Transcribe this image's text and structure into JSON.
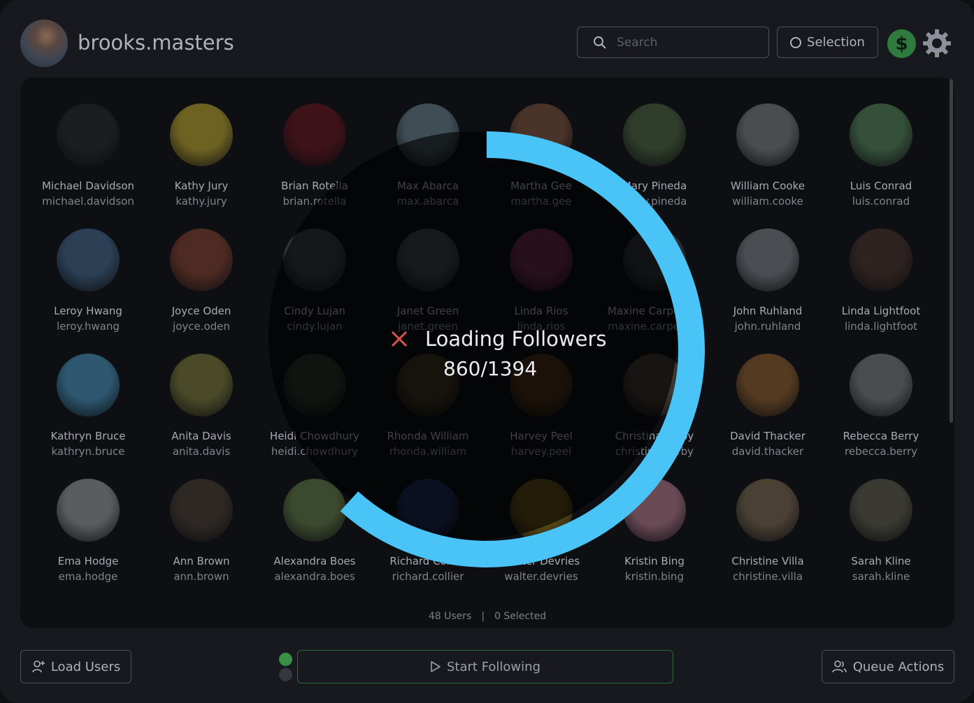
{
  "header": {
    "username": "brooks.masters",
    "search_placeholder": "Search",
    "selection_label": "Selection",
    "dollar_symbol": "$"
  },
  "users": [
    {
      "name": "Michael Davidson",
      "handle": "michael.davidson",
      "color": "#1b1d20"
    },
    {
      "name": "Kathy Jury",
      "handle": "kathy.jury",
      "color": "#6e6222"
    },
    {
      "name": "Brian Rotella",
      "handle": "brian.rotella",
      "color": "#3d1218"
    },
    {
      "name": "Max Abarca",
      "handle": "max.abarca",
      "color": "#3f4d55"
    },
    {
      "name": "Martha Gee",
      "handle": "martha.gee",
      "color": "#4a3328"
    },
    {
      "name": "Mary Pineda",
      "handle": "mary.pineda",
      "color": "#2f3d2a"
    },
    {
      "name": "William Cooke",
      "handle": "william.cooke",
      "color": "#4a4c50"
    },
    {
      "name": "Luis Conrad",
      "handle": "luis.conrad",
      "color": "#35503a"
    },
    {
      "name": "Leroy Hwang",
      "handle": "leroy.hwang",
      "color": "#2c3f55"
    },
    {
      "name": "Joyce Oden",
      "handle": "joyce.oden",
      "color": "#4d2a22"
    },
    {
      "name": "Cindy Lujan",
      "handle": "cindy.lujan",
      "color": "#3a3d40"
    },
    {
      "name": "Janet Green",
      "handle": "janet.green",
      "color": "#3f4244"
    },
    {
      "name": "Linda Rios",
      "handle": "linda.rios",
      "color": "#6b2a45"
    },
    {
      "name": "Maxine Carpenter",
      "handle": "maxine.carpenter",
      "color": "#2e3135"
    },
    {
      "name": "John Ruhland",
      "handle": "john.ruhland",
      "color": "#4a4d52"
    },
    {
      "name": "Linda Lightfoot",
      "handle": "linda.lightfoot",
      "color": "#2e2320"
    },
    {
      "name": "Kathryn Bruce",
      "handle": "kathryn.bruce",
      "color": "#2d5870"
    },
    {
      "name": "Anita Davis",
      "handle": "anita.davis",
      "color": "#4a4a28"
    },
    {
      "name": "Heidi Chowdhury",
      "handle": "heidi.chowdhury",
      "color": "#2c3328"
    },
    {
      "name": "Rhonda William",
      "handle": "rhonda.william",
      "color": "#3a3222"
    },
    {
      "name": "Harvey Peel",
      "handle": "harvey.peel",
      "color": "#4a2e18"
    },
    {
      "name": "Christina Yerby",
      "handle": "christina.yerby",
      "color": "#3e3630"
    },
    {
      "name": "David Thacker",
      "handle": "david.thacker",
      "color": "#553a22"
    },
    {
      "name": "Rebecca Berry",
      "handle": "rebecca.berry",
      "color": "#4a4c50"
    },
    {
      "name": "Ema Hodge",
      "handle": "ema.hodge",
      "color": "#5a5d60"
    },
    {
      "name": "Ann Brown",
      "handle": "ann.brown",
      "color": "#2e2824"
    },
    {
      "name": "Alexandra Boes",
      "handle": "alexandra.boes",
      "color": "#3b4a2e"
    },
    {
      "name": "Richard Collier",
      "handle": "richard.collier",
      "color": "#1e2a55"
    },
    {
      "name": "Walter Devries",
      "handle": "walter.devries",
      "color": "#5a4a18"
    },
    {
      "name": "Kristin Bing",
      "handle": "kristin.bing",
      "color": "#6a4a55"
    },
    {
      "name": "Christine Villa",
      "handle": "christine.villa",
      "color": "#4a4034"
    },
    {
      "name": "Sarah Kline",
      "handle": "sarah.kline",
      "color": "#3a3a32"
    }
  ],
  "status": {
    "users_count": "48 Users",
    "separator": "|",
    "selected_count": "0 Selected"
  },
  "loading": {
    "title": "Loading Followers",
    "progress_text": "860/1394",
    "progress_fraction": 0.617,
    "ring_color": "#4ac3f7"
  },
  "footer": {
    "load_users_label": "Load Users",
    "start_following_label": "Start Following",
    "queue_actions_label": "Queue Actions"
  },
  "colors": {
    "status_dot_active": "#3a8f47",
    "status_dot_inactive": "#34373d",
    "cancel_x": "#e05050"
  }
}
